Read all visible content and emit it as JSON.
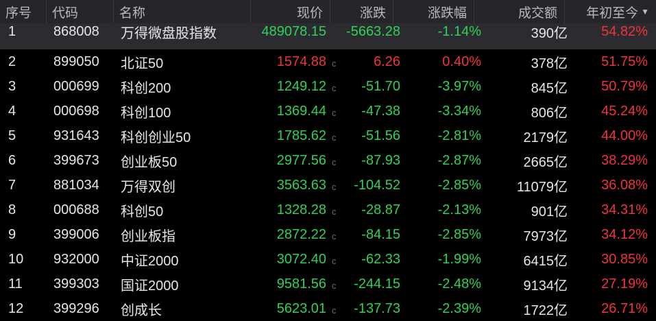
{
  "colors": {
    "up": "#f0333c",
    "down": "#2fd15a",
    "neutral": "#e6e6e6"
  },
  "header": {
    "idx": "序号",
    "code": "代码",
    "name": "名称",
    "price": "现价",
    "change": "涨跌",
    "pct": "涨跌幅",
    "amount": "成交额",
    "ytd": "年初至今",
    "sort_icon": "sort-desc-icon"
  },
  "rows": [
    {
      "idx": "1",
      "code": "868008",
      "name": "万得微盘股指数",
      "price": "489078.15",
      "flag": "",
      "change": "-5663.28",
      "pct": "-1.14%",
      "amount": "390亿",
      "ytd": "54.82%",
      "dir": "down"
    },
    {
      "idx": "2",
      "code": "899050",
      "name": "北证50",
      "price": "1574.88",
      "flag": "c",
      "change": "6.26",
      "pct": "0.40%",
      "amount": "378亿",
      "ytd": "51.75%",
      "dir": "up"
    },
    {
      "idx": "3",
      "code": "000699",
      "name": "科创200",
      "price": "1249.12",
      "flag": "c",
      "change": "-51.70",
      "pct": "-3.97%",
      "amount": "845亿",
      "ytd": "50.79%",
      "dir": "down"
    },
    {
      "idx": "4",
      "code": "000698",
      "name": "科创100",
      "price": "1369.44",
      "flag": "c",
      "change": "-47.38",
      "pct": "-3.34%",
      "amount": "806亿",
      "ytd": "45.24%",
      "dir": "down"
    },
    {
      "idx": "5",
      "code": "931643",
      "name": "科创创业50",
      "price": "1785.62",
      "flag": "c",
      "change": "-51.56",
      "pct": "-2.81%",
      "amount": "2179亿",
      "ytd": "44.00%",
      "dir": "down"
    },
    {
      "idx": "6",
      "code": "399673",
      "name": "创业板50",
      "price": "2977.56",
      "flag": "c",
      "change": "-87.93",
      "pct": "-2.87%",
      "amount": "2665亿",
      "ytd": "38.29%",
      "dir": "down"
    },
    {
      "idx": "7",
      "code": "881034",
      "name": "万得双创",
      "price": "3563.63",
      "flag": "c",
      "change": "-104.52",
      "pct": "-2.85%",
      "amount": "11079亿",
      "ytd": "36.08%",
      "dir": "down"
    },
    {
      "idx": "8",
      "code": "000688",
      "name": "科创50",
      "price": "1328.28",
      "flag": "c",
      "change": "-28.87",
      "pct": "-2.13%",
      "amount": "901亿",
      "ytd": "34.31%",
      "dir": "down"
    },
    {
      "idx": "9",
      "code": "399006",
      "name": "创业板指",
      "price": "2872.22",
      "flag": "c",
      "change": "-84.15",
      "pct": "-2.85%",
      "amount": "7973亿",
      "ytd": "34.12%",
      "dir": "down"
    },
    {
      "idx": "10",
      "code": "932000",
      "name": "中证2000",
      "price": "3072.40",
      "flag": "c",
      "change": "-62.33",
      "pct": "-1.99%",
      "amount": "6415亿",
      "ytd": "30.85%",
      "dir": "down"
    },
    {
      "idx": "11",
      "code": "399303",
      "name": "国证2000",
      "price": "9581.56",
      "flag": "c",
      "change": "-244.15",
      "pct": "-2.48%",
      "amount": "9134亿",
      "ytd": "27.19%",
      "dir": "down"
    },
    {
      "idx": "12",
      "code": "399296",
      "name": "创成长",
      "price": "5623.01",
      "flag": "c",
      "change": "-137.73",
      "pct": "-2.39%",
      "amount": "1722亿",
      "ytd": "26.71%",
      "dir": "down"
    }
  ]
}
